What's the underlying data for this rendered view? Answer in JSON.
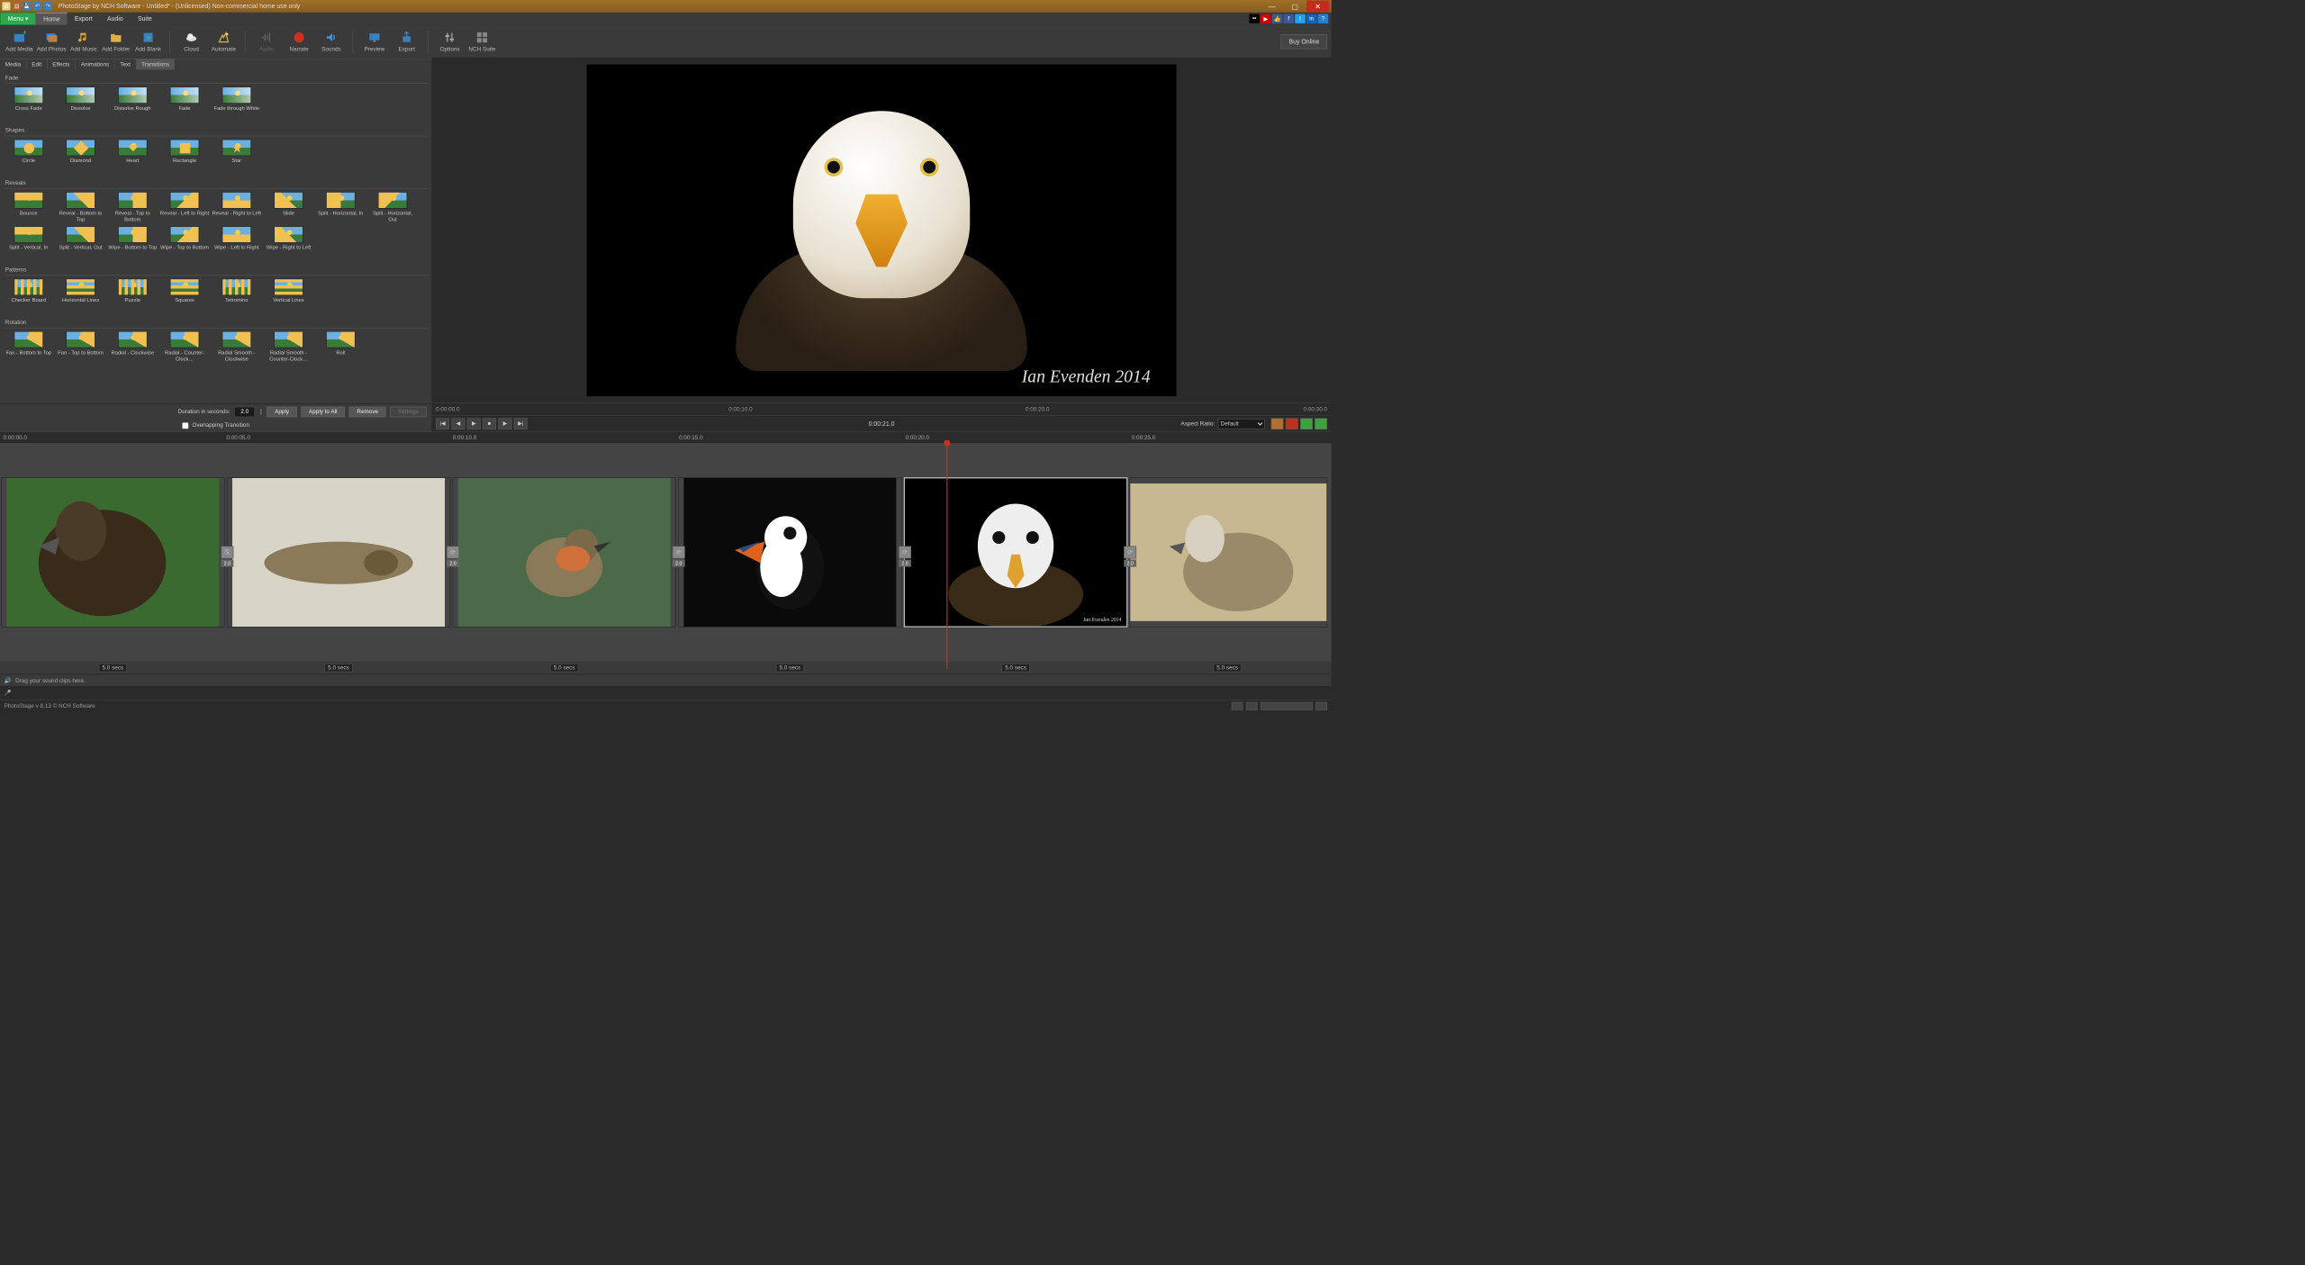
{
  "title": "PhotoStage by NCH Software - Untitled* - (Unlicensed) Non-commercial home use only",
  "menubar": {
    "menu": "Menu ▾",
    "home": "Home",
    "export": "Export",
    "audio": "Audio",
    "suite": "Suite"
  },
  "ribbon": {
    "addMedia": "Add Media",
    "addPhotos": "Add Photos",
    "addMusic": "Add Music",
    "addFolder": "Add Folder",
    "addBlank": "Add Blank",
    "cloud": "Cloud",
    "automate": "Automate",
    "audio": "Audio",
    "narrate": "Narrate",
    "sounds": "Sounds",
    "preview": "Preview",
    "export": "Export",
    "options": "Options",
    "nchSuite": "NCH Suite",
    "buy": "Buy Online"
  },
  "leftTabs": {
    "media": "Media",
    "edit": "Edit",
    "effects": "Effects",
    "animations": "Animations",
    "text": "Text",
    "transitions": "Transitions"
  },
  "sections": {
    "fade": {
      "title": "Fade",
      "items": [
        "Cross Fade",
        "Dissolve",
        "Dissolve Rough",
        "Fade",
        "Fade through White"
      ]
    },
    "shapes": {
      "title": "Shapes",
      "items": [
        "Circle",
        "Diamond",
        "Heart",
        "Rectangle",
        "Star"
      ]
    },
    "reveals": {
      "title": "Reveals",
      "items": [
        "Bounce",
        "Reveal - Bottom to Top",
        "Reveal - Top to Bottom",
        "Reveal - Left to Right",
        "Reveal - Right to Left",
        "Slide",
        "Split - Horizontal, In",
        "Split - Horizontal, Out",
        "Split - Vertical, In",
        "Split - Vertical, Out",
        "Wipe - Bottom to Top",
        "Wipe - Top to Bottom",
        "Wipe - Left to Right",
        "Wipe - Right to Left"
      ]
    },
    "patterns": {
      "title": "Patterns",
      "items": [
        "Checker Board",
        "Horizontal Lines",
        "Puzzle",
        "Squares",
        "Tetromino",
        "Vertical Lines"
      ]
    },
    "rotation": {
      "title": "Rotation",
      "items": [
        "Fan - Bottom to Top",
        "Fan - Top to Bottom",
        "Radial - Clockwise",
        "Radial - Counter-Clock…",
        "Radial Smooth - Clockwise",
        "Radial Smooth - Counter-Clock…",
        "Roll"
      ]
    }
  },
  "controls": {
    "durLabel": "Duration in seconds:",
    "durValue": "2.0",
    "apply": "Apply",
    "applyAll": "Apply to All",
    "remove": "Remove",
    "settings": "Settings",
    "overlapping": "Overlapping Transition"
  },
  "previewRuler": {
    "t0": "0:00:00.0",
    "t1": "0:00:10.0",
    "t2": "0:00:20.0",
    "t3": "0:00:30.0"
  },
  "transport": {
    "time": "0:00:21.0",
    "aspectLabel": "Aspect Ratio:",
    "aspectValue": "Default"
  },
  "timelineRuler": {
    "t0": "0:00:00.0",
    "t1": "0:00:05.0",
    "t2": "0:00:10.0",
    "t3": "0:00:15.0",
    "t4": "0:00:20.0",
    "t5": "0:00:25.0"
  },
  "clips": {
    "transDur": "2.0",
    "durations": [
      "5.0 secs",
      "5.0 secs",
      "5.0 secs",
      "5.0 secs",
      "5.0 secs",
      "5.0 secs"
    ]
  },
  "preview": {
    "credit": "Ian Evenden 2014"
  },
  "audioHint": "Drag your sound clips here.",
  "status": "PhotoStage v 8.13 © NCH Software"
}
